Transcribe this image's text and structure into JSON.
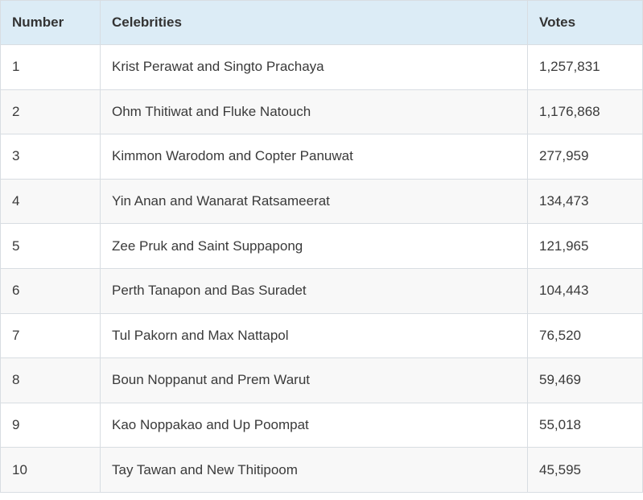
{
  "table": {
    "headers": [
      "Number",
      "Celebrities",
      "Votes"
    ],
    "rows": [
      {
        "number": "1",
        "celebrities": "Krist Perawat and Singto Prachaya",
        "votes": "1,257,831"
      },
      {
        "number": "2",
        "celebrities": "Ohm Thitiwat and Fluke Natouch",
        "votes": "1,176,868"
      },
      {
        "number": "3",
        "celebrities": "Kimmon Warodom and Copter Panuwat",
        "votes": "277,959"
      },
      {
        "number": "4",
        "celebrities": "Yin Anan and Wanarat Ratsameerat",
        "votes": "134,473"
      },
      {
        "number": "5",
        "celebrities": "Zee Pruk and Saint Suppapong",
        "votes": "121,965"
      },
      {
        "number": "6",
        "celebrities": "Perth Tanapon and Bas Suradet",
        "votes": "104,443"
      },
      {
        "number": "7",
        "celebrities": "Tul Pakorn and Max Nattapol",
        "votes": "76,520"
      },
      {
        "number": "8",
        "celebrities": "Boun Noppanut and Prem Warut",
        "votes": "59,469"
      },
      {
        "number": "9",
        "celebrities": "Kao Noppakao and Up Poompat",
        "votes": "55,018"
      },
      {
        "number": "10",
        "celebrities": "Tay Tawan and New Thitipoom",
        "votes": "45,595"
      }
    ]
  },
  "colors": {
    "header_bg": "#dcecf6",
    "border": "#d8dde2",
    "row_alt_bg": "#f8f8f8",
    "text": "#333333"
  }
}
